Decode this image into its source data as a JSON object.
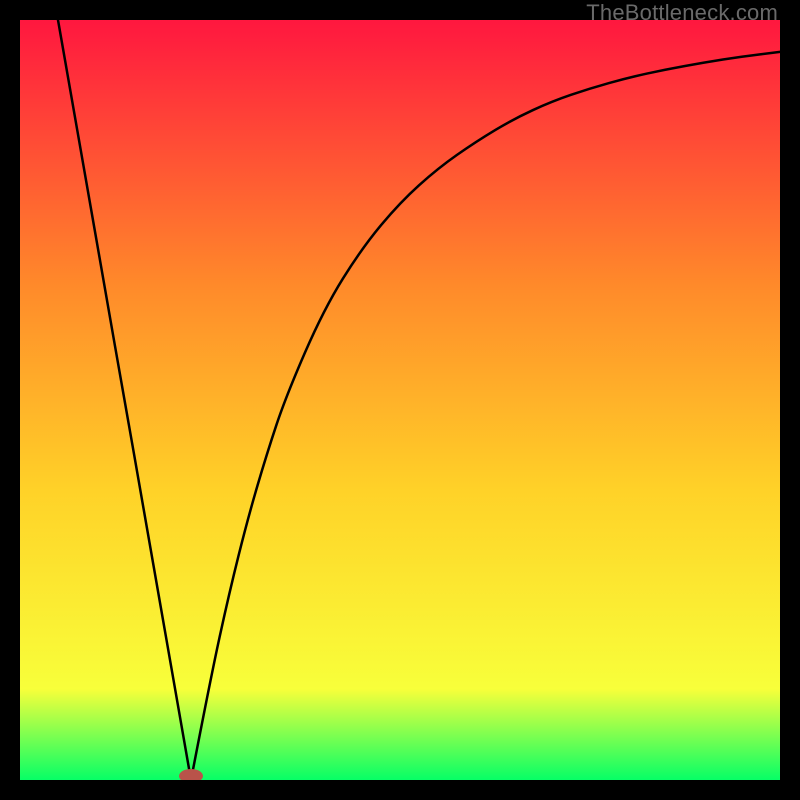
{
  "watermark": "TheBottleneck.com",
  "chart_data": {
    "type": "line",
    "title": "",
    "xlabel": "",
    "ylabel": "",
    "xlim": [
      0,
      1
    ],
    "ylim": [
      0,
      1
    ],
    "grid": false,
    "background_gradient": {
      "top": "#ff173f",
      "mid_upper": "#ff8a2a",
      "mid": "#ffd228",
      "mid_lower": "#f8ff3a",
      "bottom": "#06ff66"
    },
    "curve_color": "#000000",
    "marker": {
      "x": 0.225,
      "y": 0.0,
      "color": "#b9534a",
      "rx": 12,
      "ry": 7
    },
    "series": [
      {
        "name": "left-branch",
        "x": [
          0.05,
          0.075,
          0.1,
          0.125,
          0.15,
          0.175,
          0.2,
          0.225
        ],
        "values": [
          1.0,
          0.857,
          0.714,
          0.571,
          0.429,
          0.286,
          0.143,
          0.0
        ]
      },
      {
        "name": "right-branch",
        "x": [
          0.225,
          0.25,
          0.275,
          0.3,
          0.325,
          0.35,
          0.4,
          0.45,
          0.5,
          0.55,
          0.6,
          0.65,
          0.7,
          0.75,
          0.8,
          0.85,
          0.9,
          0.95,
          1.0
        ],
        "values": [
          0.0,
          0.13,
          0.245,
          0.345,
          0.43,
          0.505,
          0.62,
          0.7,
          0.76,
          0.805,
          0.84,
          0.87,
          0.893,
          0.91,
          0.924,
          0.935,
          0.944,
          0.952,
          0.958
        ]
      }
    ]
  }
}
